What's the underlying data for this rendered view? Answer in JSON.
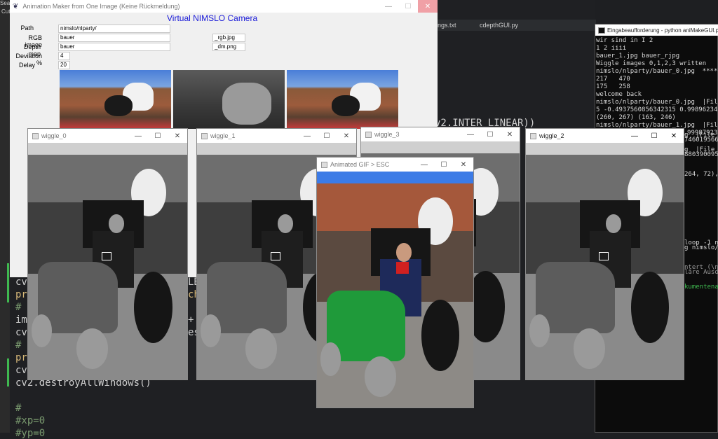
{
  "taskbar": {
    "left_label": "Sear",
    "left_label2": "Cut"
  },
  "editor": {
    "tabs": [
      "ngs.txt",
      "cdepthGUI.py"
    ],
    "code_lines": [
      {
        "text": "cv",
        "color": "#cfcfcf"
      },
      {
        "text": "pr",
        "color": "#d5b778"
      },
      {
        "text": "#",
        "color": "#7a9a6f"
      },
      {
        "text": "im",
        "color": "#cfcfcf"
      },
      {
        "text": "cv",
        "color": "#cfcfcf"
      },
      {
        "text": "#",
        "color": "#7a9a6f"
      },
      {
        "text": "pr",
        "color": "#d5b778"
      },
      {
        "text": "cv",
        "color": "#cfcfcf"
      },
      {
        "text": "cv2.destroyAllWindows()",
        "color": "#cfcfcf"
      },
      {
        "text": "",
        "color": "#cfcfcf"
      },
      {
        "text": "#",
        "color": "#7a9a6f"
      },
      {
        "text": "#xp=0",
        "color": "#7a9a6f"
      },
      {
        "text": "#yp=0",
        "color": "#7a9a6f"
      }
    ],
    "inter_linear": "v2.INTER_LINEAR))",
    "frag_1": "LB",
    "frag_2": "ch",
    "frag_3": "+",
    "frag_4": "es"
  },
  "console": {
    "title": "Eingabeaufforderung - python  aniMakeGUI.py",
    "lines": [
      "wir sind in I 2",
      "1 2 iiii",
      "bauer_1.jpg bauer_rjpg",
      "Wiggle images 0,1,2,3 written",
      "nimslo/nlparty/bauer_0.jpg  *****",
      "217   470",
      "175   258",
      "welcome back",
      "nimslo/nlparty/bauer_0.jpg  |File i",
      "5 -0.4937560856342315 0.998962342",
      "(260, 267) (163, 246)",
      "nimslo/nlparty/bauer_1.jpg  |File i",
      "5 -0.4931526780128479 0.999879237"
    ],
    "frag_lines": [
      {
        "text": "g  |File i",
        "color": "#d8d8d8"
      },
      {
        "text": "74601956605",
        "color": "#d8d8d8"
      },
      {
        "text": "g  |File i",
        "color": "#d8d8d8"
      },
      {
        "text": "88039009573",
        "color": "#d8d8d8"
      },
      {
        "text": "264, 72),",
        "color": "#d8d8d8"
      },
      {
        "text": "loop -1 n",
        "color": "#d8d8d8"
      },
      {
        "text": "g nimslo/n",
        "color": "#d8d8d8"
      },
      {
        "text": "ntert (\\n, \\y, \\",
        "color": "#9a9a9a"
      },
      {
        "text": "läre Ausdrück",
        "color": "#9a9a9a"
      },
      {
        "text": "kumentenanf",
        "color": "#3fb950"
      }
    ]
  },
  "main_window": {
    "title": "Animation Maker from One Image (Keine Rückmeldung)",
    "heading": "Virtual NIMSLO Camera",
    "fields": [
      {
        "label": "Path",
        "value": "nimslo/nlparty/"
      },
      {
        "label": "RGB image",
        "value": "bauer"
      },
      {
        "label": "Depth map",
        "value": "bauer"
      },
      {
        "label": "Deviation %",
        "value": "4"
      },
      {
        "label": "Delay",
        "value": "20"
      }
    ],
    "suffix_rgb": "_rgb.jpg",
    "suffix_dm": "_dm.png"
  },
  "windows": {
    "wiggle_0": "wiggle_0",
    "wiggle_1": "wiggle_1",
    "wiggle_3": "wiggle_3",
    "wiggle_2": "wiggle_2",
    "gif": "Animated GIF > ESC"
  },
  "icons": {
    "minimize": "—",
    "maximize": "☐",
    "close": "✕"
  },
  "colors": {
    "accent": "#1a1ad8",
    "close_hover": "#e81123"
  }
}
